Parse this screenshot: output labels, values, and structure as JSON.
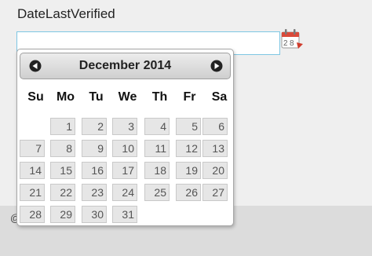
{
  "field": {
    "label": "DateLastVerified",
    "value": "",
    "placeholder": ""
  },
  "footer": {
    "stray_char": "@"
  },
  "datepicker": {
    "prev_label": "Prev",
    "next_label": "Next",
    "title": "December 2014",
    "days_of_week": [
      "Su",
      "Mo",
      "Tu",
      "We",
      "Th",
      "Fr",
      "Sa"
    ],
    "first_weekday_index": 1,
    "days": [
      "1",
      "2",
      "3",
      "4",
      "5",
      "6",
      "7",
      "8",
      "9",
      "10",
      "11",
      "12",
      "13",
      "14",
      "15",
      "16",
      "17",
      "18",
      "19",
      "20",
      "21",
      "22",
      "23",
      "24",
      "25",
      "26",
      "27",
      "28",
      "29",
      "30",
      "31"
    ]
  },
  "colors": {
    "input_border": "#7ec6e3",
    "day_cell_bg": "#e6e6e6",
    "header_bg": "#cfcfcf"
  },
  "icons": {
    "trigger": "calendar-icon",
    "prev": "circle-triangle-w-icon",
    "next": "circle-triangle-e-icon"
  }
}
